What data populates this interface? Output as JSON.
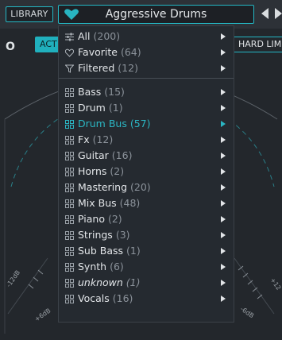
{
  "header": {
    "library_label": "LIBRARY",
    "preset_name": "Aggressive Drums",
    "prev_icon": "triangle-left",
    "next_icon": "triangle-right"
  },
  "controls": {
    "left_letter": "O",
    "active_button": "ACT",
    "hard_limit_button": "HARD LIM"
  },
  "meter": {
    "left_label": "-12dB",
    "bottom_left_label": "+6dB",
    "right_label": "+12",
    "bottom_right_label": "-6dB"
  },
  "menu": {
    "filters": [
      {
        "label": "All",
        "count": "(200)",
        "icon": "sliders"
      },
      {
        "label": "Favorite",
        "count": "(64)",
        "icon": "heart-outline"
      },
      {
        "label": "Filtered",
        "count": "(12)",
        "icon": "funnel"
      }
    ],
    "categories": [
      {
        "label": "Bass",
        "count": "(15)"
      },
      {
        "label": "Drum",
        "count": "(1)"
      },
      {
        "label": "Drum Bus",
        "count": "(57)"
      },
      {
        "label": "Fx",
        "count": "(12)"
      },
      {
        "label": "Guitar",
        "count": "(16)"
      },
      {
        "label": "Horns",
        "count": "(2)"
      },
      {
        "label": "Mastering",
        "count": "(20)"
      },
      {
        "label": "Mix Bus",
        "count": "(48)"
      },
      {
        "label": "Piano",
        "count": "(2)"
      },
      {
        "label": "Strings",
        "count": "(3)"
      },
      {
        "label": "Sub Bass",
        "count": "(1)"
      },
      {
        "label": "Synth",
        "count": "(6)"
      },
      {
        "label": "unknown",
        "count": "(1)"
      },
      {
        "label": "Vocals",
        "count": "(16)"
      }
    ],
    "active_category": "Drum Bus"
  },
  "colors": {
    "accent": "#24b7c4",
    "panel": "#262a2f",
    "menu": "#252a30",
    "text": "#e2e5e8",
    "muted": "#8b929a",
    "side_strip": "#c9c9c9"
  }
}
